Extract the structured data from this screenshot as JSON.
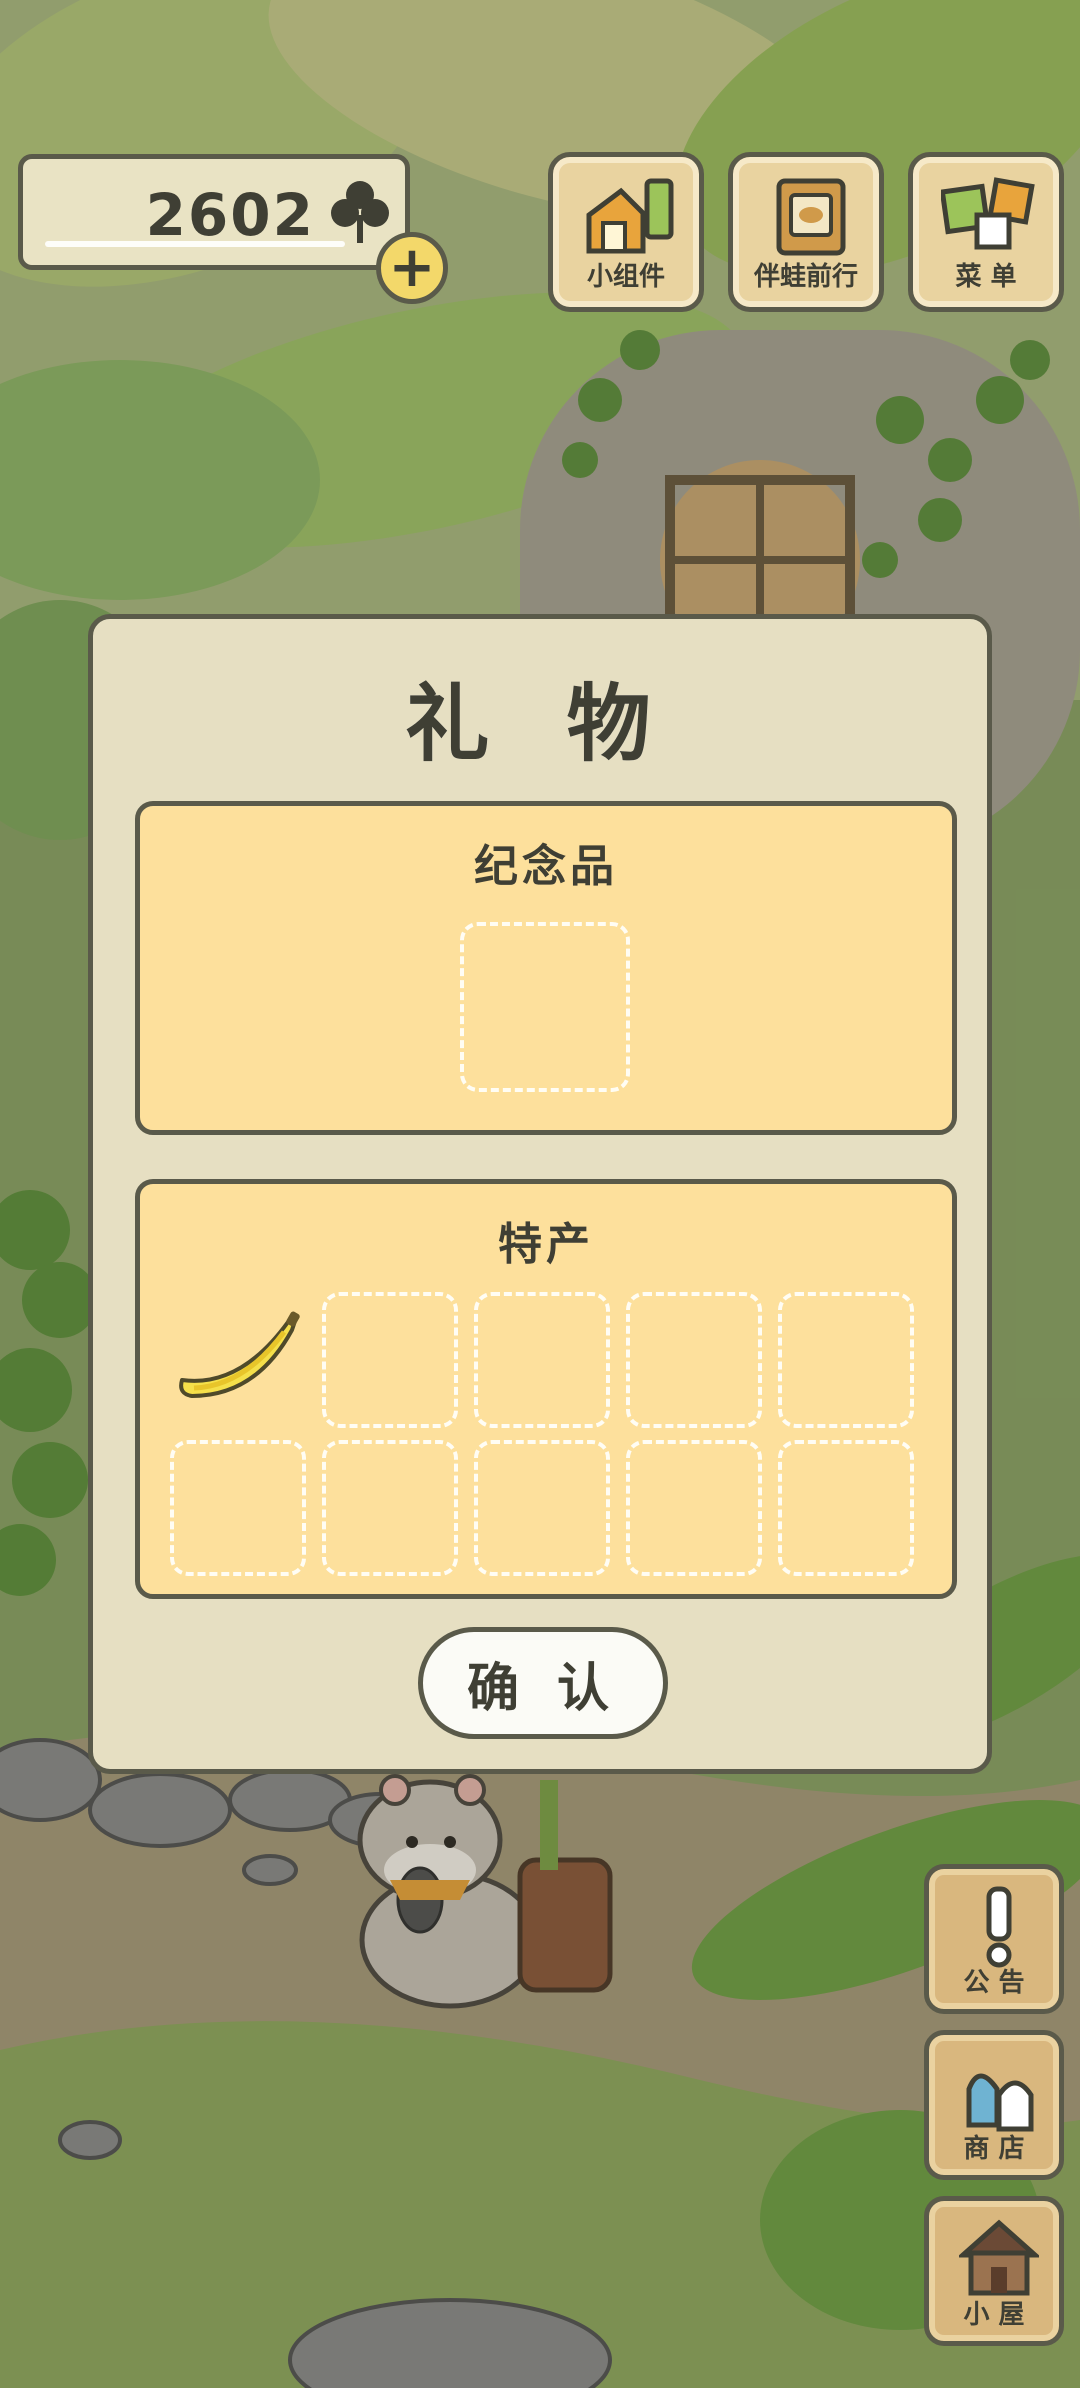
{
  "hud": {
    "clover_count": "2602",
    "clover_icon": "clover-icon",
    "plus_icon": "plus-icon",
    "plus_symbol": "+",
    "buttons": [
      {
        "label": "小组件",
        "icon": "widget-icon"
      },
      {
        "label": "伴蛙前行",
        "icon": "journal-icon"
      },
      {
        "label": "菜 单",
        "icon": "menu-icon"
      }
    ]
  },
  "side_buttons": [
    {
      "label": "公 告",
      "icon": "exclamation-icon"
    },
    {
      "label": "商 店",
      "icon": "shop-bags-icon"
    },
    {
      "label": "小 屋",
      "icon": "house-icon"
    }
  ],
  "modal": {
    "title": "礼 物",
    "souvenir": {
      "title": "纪念品"
    },
    "specialty": {
      "title": "特产",
      "first_item_icon": "banana-icon"
    },
    "confirm_label": "确 认"
  },
  "colors": {
    "panel": "#fde09c",
    "modal_bg": "#e6dfc2",
    "outline": "#5a5a4a",
    "text": "#3f3f34"
  }
}
